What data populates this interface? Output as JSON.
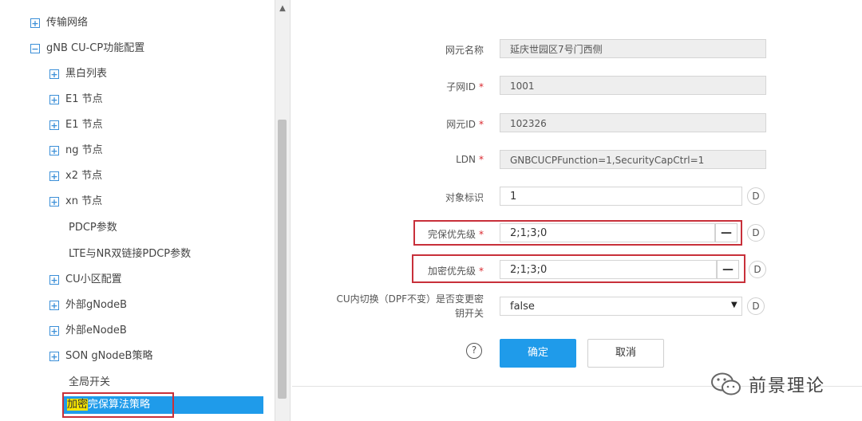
{
  "tree": {
    "items": [
      {
        "label": "传输网络",
        "toggle": "+"
      },
      {
        "label": "gNB CU-CP功能配置",
        "toggle": "−"
      },
      {
        "label": "黑白列表",
        "toggle": "+"
      },
      {
        "label": "E1 节点",
        "toggle": "+"
      },
      {
        "label": "E1 节点",
        "toggle": "+"
      },
      {
        "label": "ng 节点",
        "toggle": "+"
      },
      {
        "label": "x2 节点",
        "toggle": "+"
      },
      {
        "label": "xn 节点",
        "toggle": "+"
      },
      {
        "label": "PDCP参数",
        "toggle": ""
      },
      {
        "label": "LTE与NR双链接PDCP参数",
        "toggle": ""
      },
      {
        "label": "CU小区配置",
        "toggle": "+"
      },
      {
        "label": "外部gNodeB",
        "toggle": "+"
      },
      {
        "label": "外部eNodeB",
        "toggle": "+"
      },
      {
        "label": "SON gNodeB策略",
        "toggle": "+"
      },
      {
        "label": "全局开关",
        "toggle": ""
      }
    ],
    "selected": {
      "highlight": "加密",
      "rest": "完保算法策略"
    }
  },
  "scrollbar": {
    "up_arrow": "▲"
  },
  "form": {
    "ne_name": {
      "label": "网元名称",
      "value": "延庆世园区7号门西侧"
    },
    "subnet_id": {
      "label": "子网ID",
      "value": "1001"
    },
    "ne_id": {
      "label": "网元ID",
      "value": "102326"
    },
    "ldn": {
      "label": "LDN",
      "value": "GNBCUCPFunction=1,SecurityCapCtrl=1"
    },
    "object_id": {
      "label": "对象标识",
      "value": "1"
    },
    "integrity_priority": {
      "label": "完保优先级",
      "value": "2;1;3;0"
    },
    "cipher_priority": {
      "label": "加密优先级",
      "value": "2;1;3;0"
    },
    "cu_handover": {
      "label_line1": "CU内切换（DPF不变）是否变更密",
      "label_line2": "钥开关",
      "value": "false"
    },
    "required_mark": "*",
    "minus_label": "—",
    "d_label": "D",
    "select_arrow": "▼",
    "help_label": "?",
    "ok_label": "确定",
    "cancel_label": "取消"
  },
  "watermark": {
    "text": "前景理论"
  }
}
